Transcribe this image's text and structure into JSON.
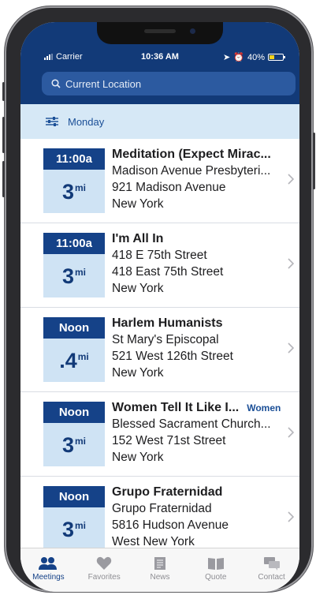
{
  "status": {
    "carrier": "Carrier",
    "time": "10:36 AM",
    "battery": "40%",
    "battery_level": 0.4
  },
  "search": {
    "placeholder": "Current Location"
  },
  "filter": {
    "day": "Monday"
  },
  "meetings": [
    {
      "time": "11:00a",
      "distance": "3",
      "unit": "mi",
      "name": "Meditation (Expect Mirac...",
      "tag": "",
      "location": "Madison Avenue Presbyteri...",
      "address": "921 Madison Avenue",
      "city": "New York"
    },
    {
      "time": "11:00a",
      "distance": "3",
      "unit": "mi",
      "name": "I'm All In",
      "tag": "",
      "location": "418 E 75th Street",
      "address": "418 East 75th Street",
      "city": "New York"
    },
    {
      "time": "Noon",
      "distance": ".4",
      "unit": "mi",
      "name": "Harlem Humanists",
      "tag": "",
      "location": "St Mary's Episcopal",
      "address": "521 West 126th Street",
      "city": "New York"
    },
    {
      "time": "Noon",
      "distance": "3",
      "unit": "mi",
      "name": "Women Tell It Like I...",
      "tag": "Women",
      "location": "Blessed Sacrament Church...",
      "address": "152 West 71st Street",
      "city": "New York"
    },
    {
      "time": "Noon",
      "distance": "3",
      "unit": "mi",
      "name": "Grupo Fraternidad",
      "tag": "",
      "location": "Grupo Fraternidad",
      "address": "5816 Hudson Avenue",
      "city": "West New York"
    }
  ],
  "tabs": [
    {
      "label": "Meetings",
      "icon": "people-icon",
      "active": true
    },
    {
      "label": "Favorites",
      "icon": "heart-icon",
      "active": false
    },
    {
      "label": "News",
      "icon": "document-icon",
      "active": false
    },
    {
      "label": "Quote",
      "icon": "book-icon",
      "active": false
    },
    {
      "label": "Contact",
      "icon": "chat-icon",
      "active": false
    }
  ],
  "colors": {
    "header": "#123a78",
    "accent": "#154288",
    "light": "#d6e8f6"
  }
}
